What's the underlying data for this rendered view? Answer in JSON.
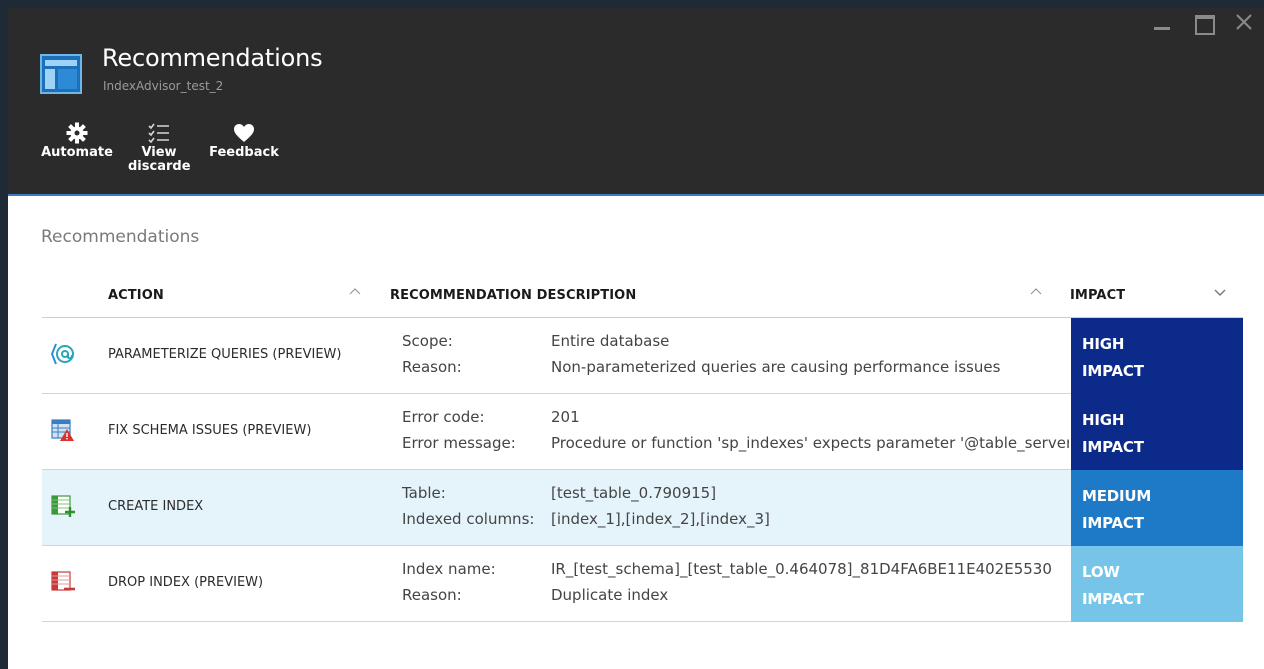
{
  "window": {
    "title": "Recommendations",
    "subtitle": "IndexAdvisor_test_2"
  },
  "toolbar": {
    "automate": "Automate",
    "view_discarded_1": "View",
    "view_discarded_2": "discarded",
    "feedback": "Feedback"
  },
  "section": {
    "label": "Recommendations"
  },
  "table": {
    "headers": {
      "action": "ACTION",
      "description": "RECOMMENDATION DESCRIPTION",
      "impact": "IMPACT"
    },
    "rows": [
      {
        "icon": "parameterize-icon",
        "action": "PARAMETERIZE QUERIES (PREVIEW)",
        "label1": "Scope:",
        "value1": "Entire database",
        "label2": "Reason:",
        "value2": "Non-parameterized queries are causing performance issues",
        "impact1": "HIGH",
        "impact2": "IMPACT",
        "impact_color": "#0b2a8a"
      },
      {
        "icon": "schema-error-icon",
        "action": "FIX SCHEMA ISSUES (PREVIEW)",
        "label1": "Error code:",
        "value1": "201",
        "label2": "Error message:",
        "value2": "Procedure or function 'sp_indexes' expects parameter '@table_server'",
        "impact1": "HIGH",
        "impact2": "IMPACT",
        "impact_color": "#0b2a8a"
      },
      {
        "icon": "create-index-icon",
        "action": "CREATE INDEX",
        "label1": "Table:",
        "value1": "[test_table_0.790915]",
        "label2": "Indexed columns:",
        "value2": "[index_1],[index_2],[index_3]",
        "impact1": "MEDIUM",
        "impact2": "IMPACT",
        "impact_color": "#1e79c6"
      },
      {
        "icon": "drop-index-icon",
        "action": "DROP INDEX (PREVIEW)",
        "label1": "Index name:",
        "value1": "IR_[test_schema]_[test_table_0.464078]_81D4FA6BE11E402E5530",
        "label2": "Reason:",
        "value2": "Duplicate index",
        "impact1": "LOW",
        "impact2": "IMPACT",
        "impact_color": "#76c5e8"
      }
    ]
  },
  "colors": {
    "header_bg": "#2b2b2b",
    "accent": "#3b7cc4",
    "selected_row": "#e5f4fb"
  }
}
